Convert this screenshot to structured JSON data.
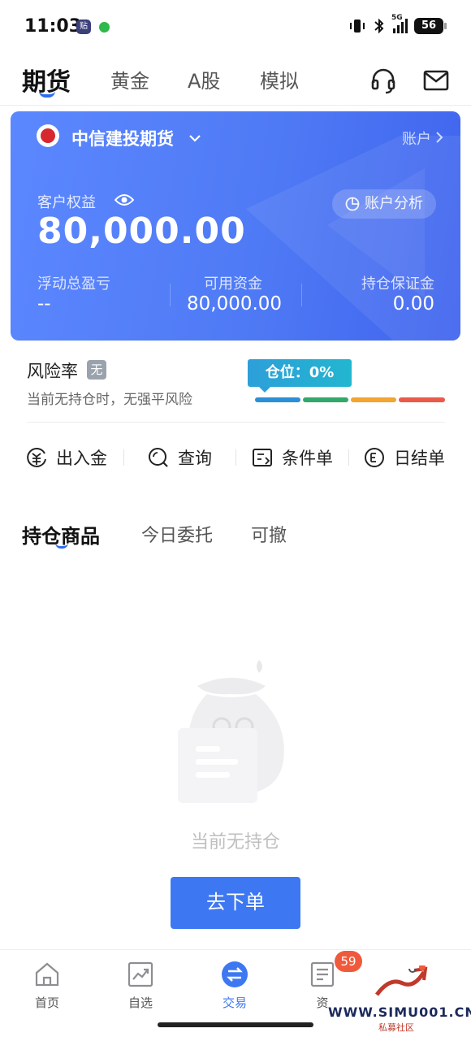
{
  "status_bar": {
    "time": "11:03",
    "app_badge": "贴",
    "signal_label": "5G",
    "battery": "56"
  },
  "top_nav": {
    "tabs": [
      {
        "label": "期货",
        "active": true
      },
      {
        "label": "黄金",
        "active": false
      },
      {
        "label": "A股",
        "active": false
      },
      {
        "label": "模拟",
        "active": false
      }
    ],
    "icons": [
      "headset-icon",
      "mail-icon"
    ]
  },
  "account_card": {
    "broker_name": "中信建投期货",
    "account_link": "账户",
    "equity_label": "客户权益",
    "equity_value": "80,000.00",
    "analysis_label": "账户分析",
    "stats": [
      {
        "label": "浮动总盈亏",
        "value": "--"
      },
      {
        "label": "可用资金",
        "value": "80,000.00"
      },
      {
        "label": "持仓保证金",
        "value": "0.00"
      }
    ],
    "colors": {
      "start": "#5b87ff",
      "end": "#3f64ee"
    }
  },
  "risk": {
    "title": "风险率",
    "badge": "无",
    "description": "当前无持仓时，无强平风险",
    "position_tag": "仓位：0%",
    "position_level": 0,
    "bar_colors": [
      "#2b8fd6",
      "#33a86a",
      "#f3a431",
      "#ea5a4a"
    ]
  },
  "actions": [
    {
      "label": "出入金",
      "icon": "transfer-funds-icon"
    },
    {
      "label": "查询",
      "icon": "search-icon"
    },
    {
      "label": "条件单",
      "icon": "conditional-order-icon"
    },
    {
      "label": "日结单",
      "icon": "daily-statement-icon"
    }
  ],
  "position_tabs": [
    {
      "label": "持仓商品",
      "active": true
    },
    {
      "label": "今日委托",
      "active": false
    },
    {
      "label": "可撤",
      "active": false
    }
  ],
  "empty_state": {
    "text": "当前无持仓",
    "button": "去下单"
  },
  "bottom_nav": {
    "items": [
      {
        "label": "首页",
        "icon": "home-icon",
        "active": false
      },
      {
        "label": "自选",
        "icon": "watchlist-icon",
        "active": false
      },
      {
        "label": "交易",
        "icon": "trade-icon",
        "active": true
      },
      {
        "label": "资",
        "icon": "info-icon",
        "active": false
      }
    ],
    "badge": "59"
  },
  "watermark": {
    "text": "WWW.SIMU001.CN",
    "sub": "私募社区"
  },
  "accent_color": "#3d78f2"
}
